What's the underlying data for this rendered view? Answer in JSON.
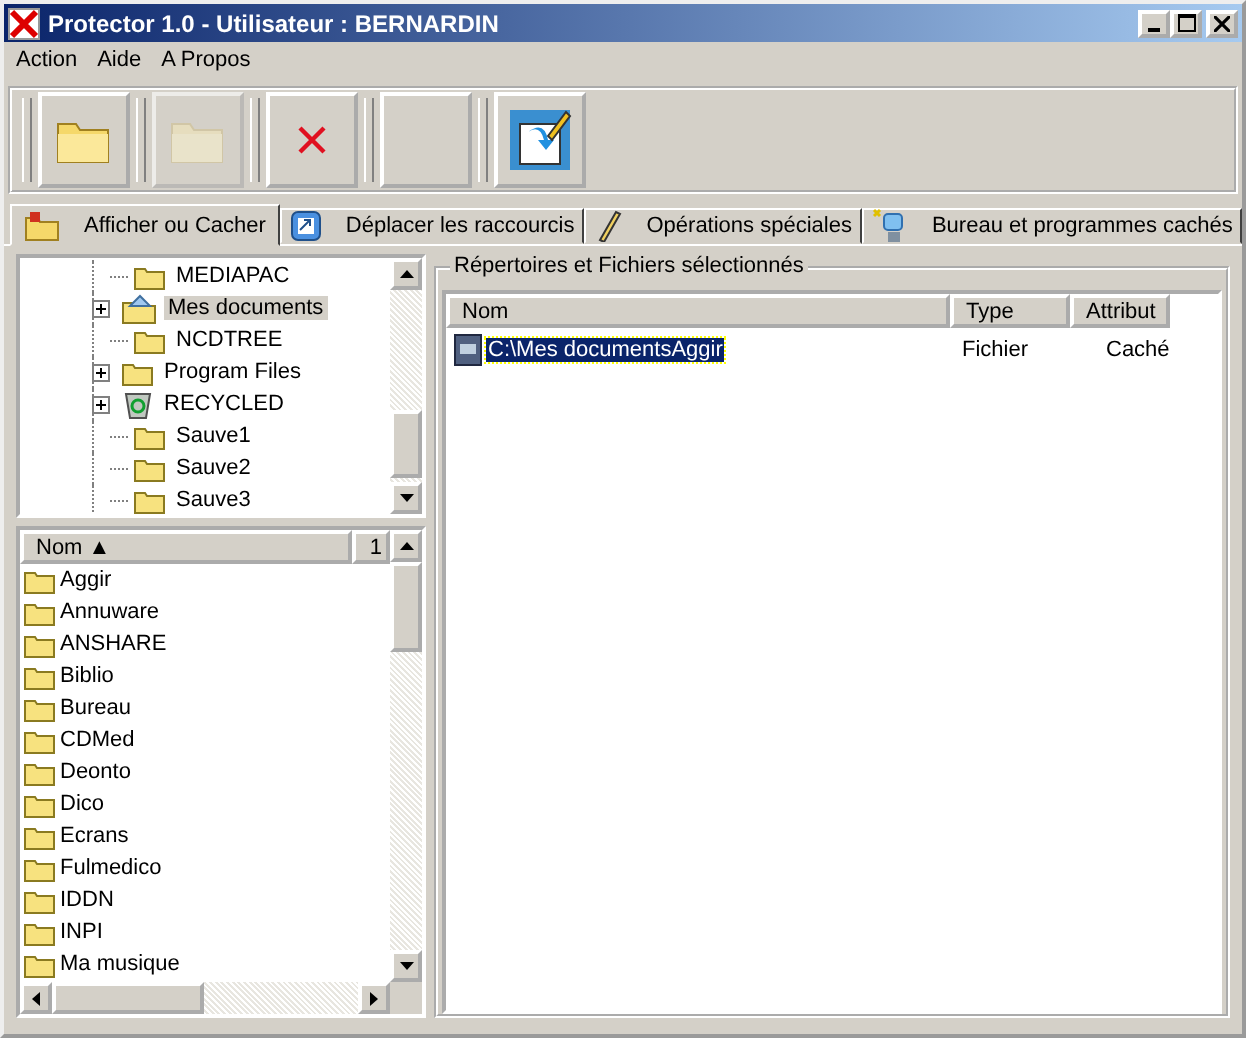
{
  "window": {
    "title": "Protector 1.0 - Utilisateur : BERNARDIN"
  },
  "menu": [
    "Action",
    "Aide",
    "A Propos"
  ],
  "toolbar": [
    {
      "kind": "folder",
      "disabled": false
    },
    {
      "kind": "folder",
      "disabled": true
    },
    {
      "kind": "delete",
      "disabled": false
    },
    {
      "kind": "blank",
      "disabled": false
    },
    {
      "kind": "edit",
      "disabled": false
    }
  ],
  "tabs": [
    {
      "label": "Afficher ou Cacher",
      "kind": "show",
      "selected": true
    },
    {
      "label": "Déplacer les raccourcis",
      "kind": "move",
      "selected": false
    },
    {
      "label": "Opérations spéciales",
      "kind": "special",
      "selected": false
    },
    {
      "label": "Bureau et programmes cachés",
      "kind": "desktop",
      "selected": false
    }
  ],
  "tree": {
    "items": [
      {
        "label": "MEDIAPAC",
        "kind": "folder",
        "expandable": false,
        "selected": false
      },
      {
        "label": "Mes documents",
        "kind": "shared-folder",
        "expandable": true,
        "selected": true
      },
      {
        "label": "NCDTREE",
        "kind": "folder",
        "expandable": false,
        "selected": false
      },
      {
        "label": "Program Files",
        "kind": "folder",
        "expandable": true,
        "selected": false
      },
      {
        "label": "RECYCLED",
        "kind": "recycle-bin",
        "expandable": true,
        "selected": false
      },
      {
        "label": "Sauve1",
        "kind": "folder",
        "expandable": false,
        "selected": false
      },
      {
        "label": "Sauve2",
        "kind": "folder",
        "expandable": false,
        "selected": false
      },
      {
        "label": "Sauve3",
        "kind": "folder",
        "expandable": false,
        "selected": false
      }
    ]
  },
  "file_list": {
    "columns": [
      "Nom ▲",
      "1"
    ],
    "items": [
      "Aggir",
      "Annuware",
      "ANSHARE",
      "Biblio",
      "Bureau",
      "CDMed",
      "Deonto",
      "Dico",
      "Ecrans",
      "Fulmedico",
      "IDDN",
      "INPI",
      "Ma musique"
    ]
  },
  "selection": {
    "title": "Répertoires et Fichiers sélectionnés",
    "columns": [
      "Nom",
      "Type",
      "Attribut"
    ],
    "rows": [
      {
        "name": "C:\\Mes documentsAggir",
        "type": "Fichier",
        "attribute": "Caché",
        "selected": true
      }
    ]
  }
}
